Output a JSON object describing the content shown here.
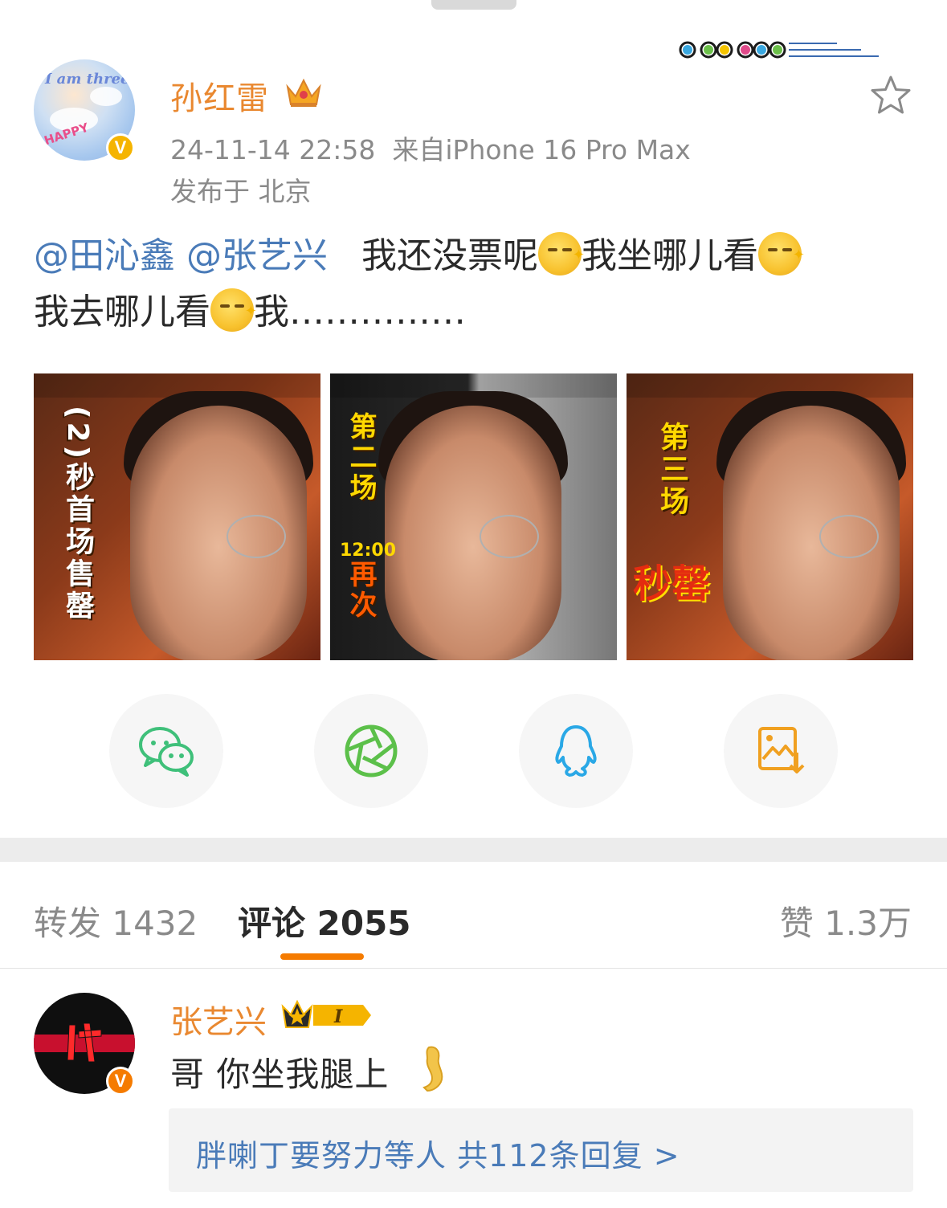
{
  "post": {
    "username": "孙红雷",
    "timestamp": "24-11-14 22:58",
    "source": "来自iPhone 16 Pro Max",
    "location": "发布于 北京",
    "avatar_text": "I am three",
    "avatar_subtext": "HAPPY",
    "mention1": "@田沁鑫",
    "mention2": "@张艺兴",
    "text1": "我还没票呢",
    "text2": "我坐哪儿看",
    "text3": "我去哪儿看",
    "text4": "我……………",
    "images": [
      {
        "overlay": "(2)秒首场售罄"
      },
      {
        "overlay": "第二场",
        "time": "12:00",
        "overlay2": "再次"
      },
      {
        "overlay": "第三场",
        "overlay2": "秒罄"
      }
    ]
  },
  "share": {
    "items": [
      "wechat-icon",
      "moments-icon",
      "qq-icon",
      "save-image-icon"
    ]
  },
  "tabs": {
    "repost": "转发 1432",
    "comments": "评论 2055",
    "likes": "赞 1.3万"
  },
  "comment": {
    "username": "张艺兴",
    "badge_level": "I",
    "text": "哥 你坐我腿上",
    "reply_summary": "胖喇丁要努力等人  共112条回复 >"
  },
  "colors": {
    "username": "#e98830",
    "mention": "#4a7bb8",
    "accent": "#f57b00",
    "verified": "#f5b400"
  }
}
